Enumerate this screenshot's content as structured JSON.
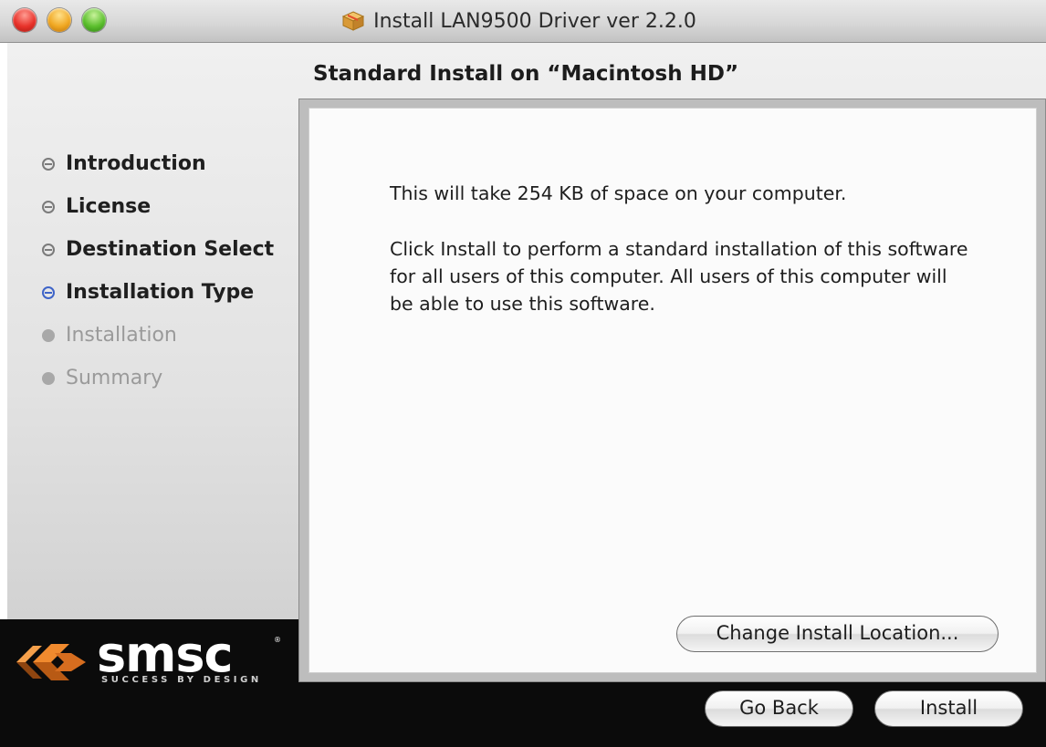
{
  "window": {
    "title": "Install LAN9500 Driver ver 2.2.0"
  },
  "heading": "Standard Install on “Macintosh HD”",
  "steps": [
    {
      "label": "Introduction",
      "state": "done"
    },
    {
      "label": "License",
      "state": "done"
    },
    {
      "label": "Destination Select",
      "state": "done"
    },
    {
      "label": "Installation Type",
      "state": "current"
    },
    {
      "label": "Installation",
      "state": "pending"
    },
    {
      "label": "Summary",
      "state": "pending"
    }
  ],
  "main": {
    "space_text": "This will take 254 KB of space on your computer.",
    "description": "Click Install to perform a standard installation of this software for all users of this computer. All users of this computer will be able to use this software."
  },
  "buttons": {
    "change_location": "Change Install Location...",
    "go_back": "Go Back",
    "install": "Install"
  },
  "brand": {
    "logo_text": "smsc",
    "tagline": "SUCCESS BY DESIGN"
  },
  "colors": {
    "current_step": "#3e64c8",
    "footer": "#0b0b0b",
    "logo_orange": "#e87722"
  }
}
